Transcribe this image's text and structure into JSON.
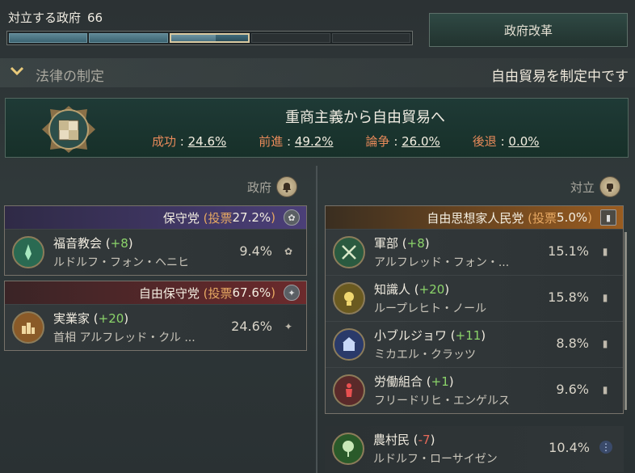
{
  "opposition": {
    "title": "対立する政府",
    "value": "66",
    "segments_total": 6,
    "segments_filled": 2,
    "current_segment_fill": 0.58
  },
  "reform_button": "政府改革",
  "law": {
    "section_label": "法律の制定",
    "status": "自由貿易を制定中です",
    "title": "重商主義から自由貿易へ",
    "stats": [
      {
        "label": "成功",
        "value": "24.6%"
      },
      {
        "label": "前進",
        "value": "49.2%"
      },
      {
        "label": "論争",
        "value": "26.0%"
      },
      {
        "label": "後退",
        "value": "0.0%"
      }
    ]
  },
  "government": {
    "label": "政府",
    "icon": "bell-icon",
    "parties": [
      {
        "name": "保守党",
        "votes_prefix": "(投票 ",
        "votes": "27.2%",
        "votes_suffix": ")",
        "color": "#5a4a86",
        "groups": [
          {
            "name": "福音教会",
            "mod": "+8",
            "leader": "ルドルフ・フォン・ヘニヒ",
            "share": "9.4%",
            "color": "#2f7a5e"
          }
        ]
      },
      {
        "name": "自由保守党",
        "votes_prefix": "(投票 ",
        "votes": "67.6%",
        "votes_suffix": ")",
        "color": "#7a3032",
        "groups": [
          {
            "name": "実業家",
            "mod": "+20",
            "leader": "首相 アルフレッド・クル ...",
            "share": "24.6%",
            "color": "#a06a30"
          }
        ]
      }
    ]
  },
  "opposition_side": {
    "label": "対立",
    "icon": "fist-icon",
    "parties": [
      {
        "name": "自由思想家人民党",
        "votes_prefix": "(投票 ",
        "votes": "5.0%",
        "votes_suffix": ")",
        "color": "#8a5a26",
        "groups": [
          {
            "name": "軍部",
            "mod": "+8",
            "leader": "アルフレッド・フォン・...",
            "share": "15.1%",
            "color": "#2f6a4a"
          },
          {
            "name": "知識人",
            "mod": "+20",
            "leader": "ループレヒト・ノール",
            "share": "15.8%",
            "color": "#c0a040"
          },
          {
            "name": "小ブルジョワ",
            "mod": "+11",
            "leader": "ミカエル・クラッツ",
            "share": "8.8%",
            "color": "#3a5a9a"
          },
          {
            "name": "労働組合",
            "mod": "+1",
            "leader": "フリードリヒ・エンゲルス",
            "share": "9.6%",
            "color": "#b03030"
          }
        ]
      }
    ],
    "independent": {
      "name": "農村民",
      "mod": "-7",
      "leader": "ルドルフ・ローサイゼン",
      "share": "10.4%",
      "color": "#3a7a3a"
    }
  }
}
